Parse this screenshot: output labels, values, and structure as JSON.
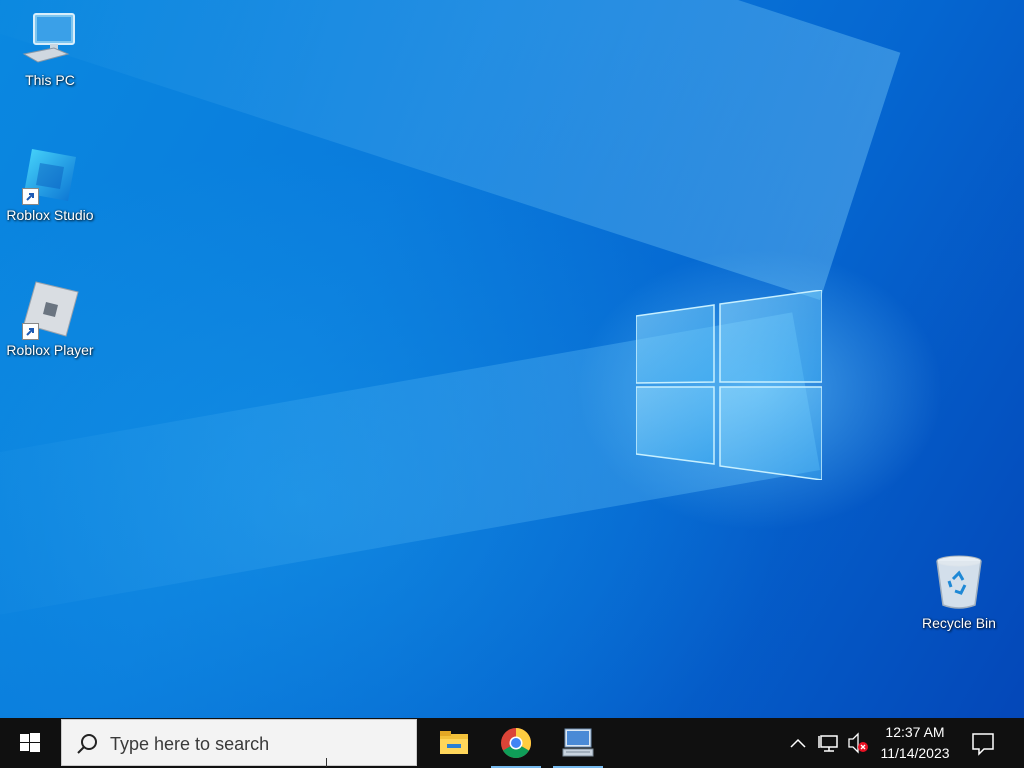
{
  "desktop": {
    "icons": [
      {
        "label": "This PC",
        "icon": "computer-icon"
      },
      {
        "label": "Roblox Studio",
        "icon": "roblox-studio-icon"
      },
      {
        "label": "Roblox Player",
        "icon": "roblox-player-icon"
      },
      {
        "label": "Recycle Bin",
        "icon": "recycle-bin-icon"
      }
    ]
  },
  "taskbar": {
    "search_placeholder": "Type here to search",
    "pinned_apps": [
      {
        "name": "File Explorer",
        "icon": "folder-icon"
      },
      {
        "name": "Google Chrome",
        "icon": "chrome-icon"
      },
      {
        "name": "Remote Desktop",
        "icon": "remote-desktop-icon"
      }
    ],
    "tray": {
      "time": "12:37 AM",
      "date": "11/14/2023",
      "icons": [
        "chevron-up-icon",
        "network-icon",
        "volume-muted-icon",
        "notification-icon"
      ]
    }
  },
  "colors": {
    "desktop_blue": "#0a7bdc",
    "taskbar_bg": "#101010",
    "active_underline": "#76b9ed"
  }
}
